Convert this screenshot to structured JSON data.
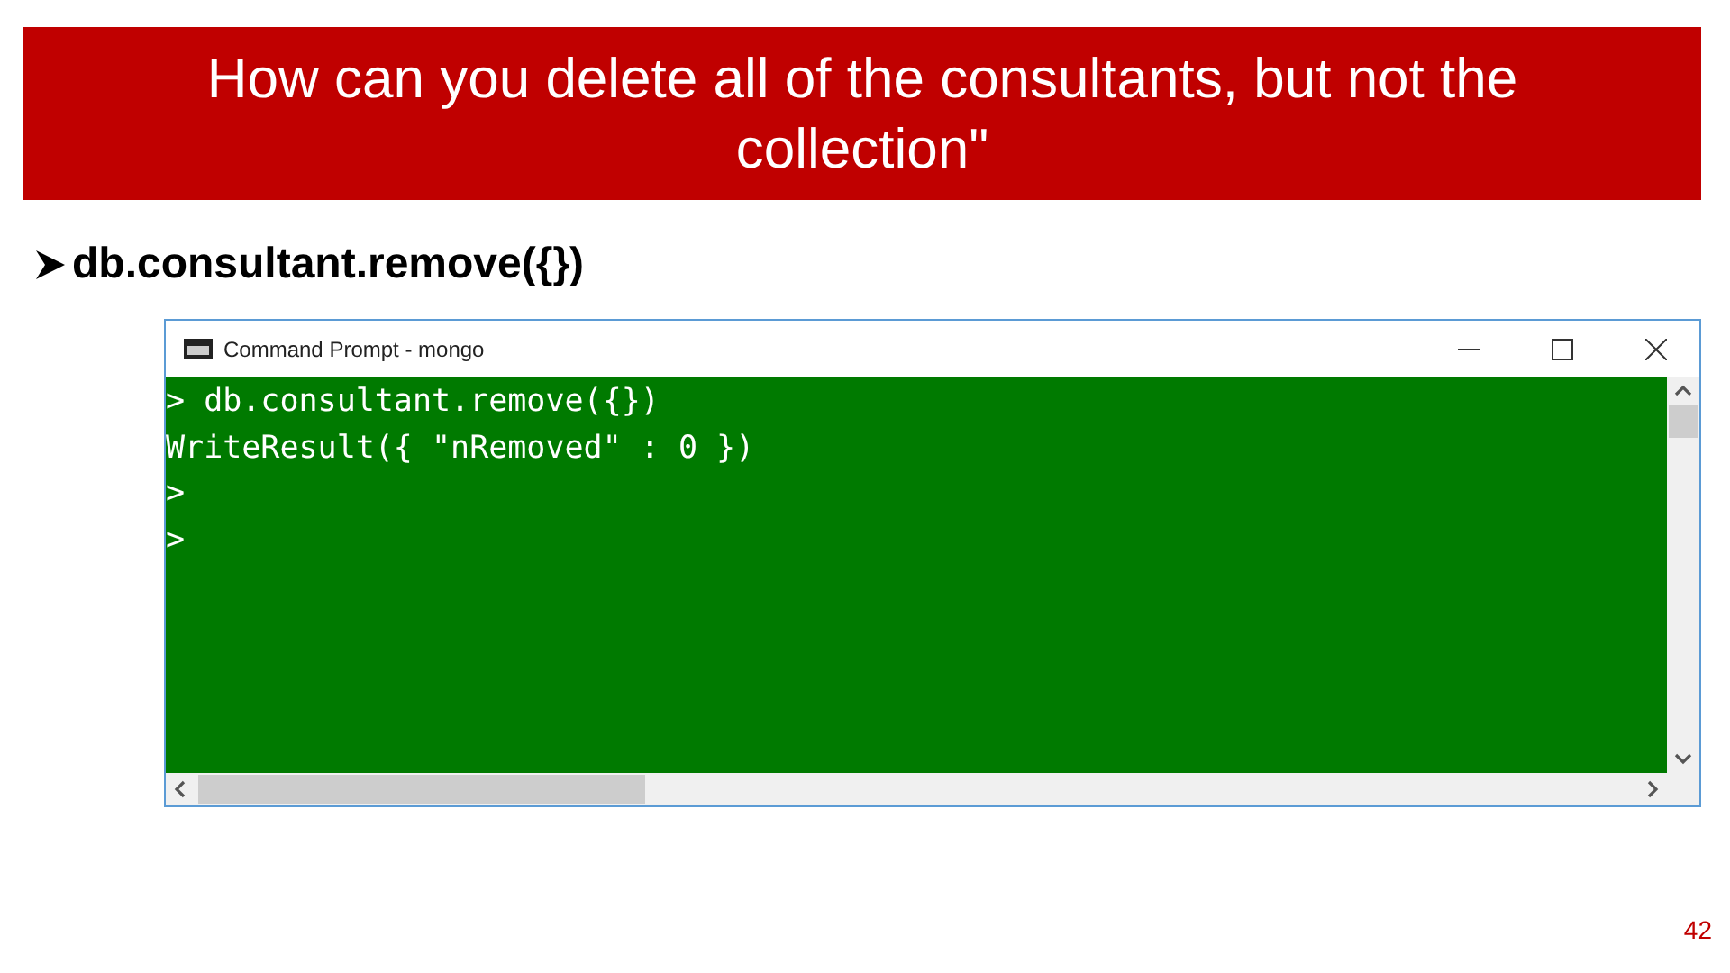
{
  "slide": {
    "title": "How can you delete all of the consultants, but not the collection\"",
    "bullets": [
      "db.consultant.remove({})"
    ],
    "page_number": "42"
  },
  "window": {
    "title": "Command Prompt - mongo",
    "console_lines": [
      "> db.consultant.remove({})",
      "WriteResult({ \"nRemoved\" : 0 })",
      ">",
      ">"
    ]
  }
}
